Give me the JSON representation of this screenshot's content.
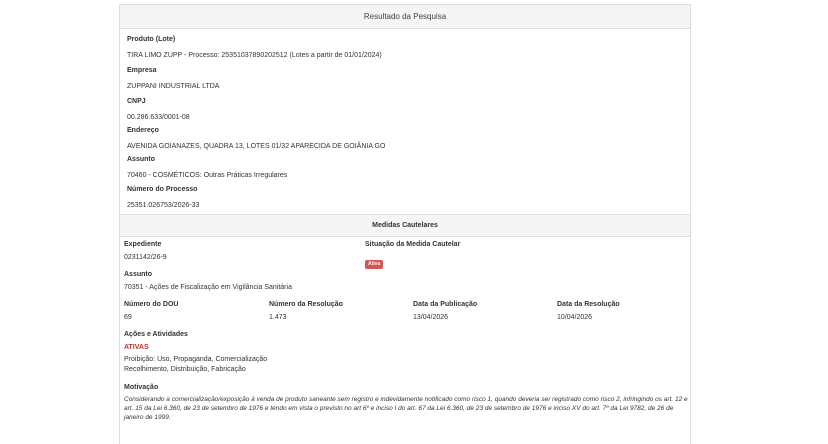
{
  "header": {
    "title": "Resultado da Pesquisa"
  },
  "produto": {
    "label": "Produto (Lote)",
    "value": "TIRA LIMO ZUPP - Processo: 25351037890202512 (Lotes a partir de 01/01/2024)"
  },
  "empresa": {
    "label": "Empresa",
    "value": "ZUPPANI INDUSTRIAL LTDA"
  },
  "cnpj": {
    "label": "CNPJ",
    "value": "00.286.633/0001-08"
  },
  "endereco": {
    "label": "Endereço",
    "value": "AVENIDA GOIANAZES, QUADRA 13, LOTES 01/32 APARECIDA DE GOIÂNIA GO"
  },
  "assunto": {
    "label": "Assunto",
    "value": "70460 - COSMÉTICOS: Outras Práticas Irregulares"
  },
  "numero_processo": {
    "label": "Número do Processo",
    "value": "25351.026753/2026-33"
  },
  "medidas": {
    "title": "Medidas Cautelares",
    "expediente": {
      "label": "Expediente",
      "value": "0231142/26-9"
    },
    "situacao": {
      "label": "Situação da Medida Cautelar",
      "badge": "Ativa"
    },
    "assunto": {
      "label": "Assunto",
      "value": "70351 - Ações de Fiscalização em Vigilância Sanitária"
    },
    "numero_dou": {
      "label": "Número do DOU",
      "value": "69"
    },
    "numero_resolucao": {
      "label": "Número da Resolução",
      "value": "1.473"
    },
    "data_publicacao": {
      "label": "Data da Publicação",
      "value": "13/04/2026"
    },
    "data_resolucao": {
      "label": "Data da Resolução",
      "value": "10/04/2026"
    },
    "acoes": {
      "label": "Ações e Atividades",
      "status": "ATIVAS",
      "line1": "Proibição: Uso, Propaganda, Comercialização",
      "line2": "Recolhimento, Distribuição, Fabricação"
    },
    "motivacao": {
      "label": "Motivação",
      "text": "Considerando a comercialização/exposição à venda de produto saneante sem registro e indevidamente notificado como risco 1, quando deveria ser registrado como risco 2, infringindo os art. 12 e art. 15 da Lei 6.360, de 23 de setembro de 1976 e tendo em vista o previsto no art 6º e inciso I do art. 67 da Lei 6.360, de 23 de setembro de 1976 e inciso XV do art. 7º da Lei 9782, de 26 de janeiro de 1999."
    }
  },
  "colors": {
    "badge": "#d9534f",
    "status": "#c9302c",
    "header_bg": "#f5f5f5",
    "border": "#dddddd"
  }
}
